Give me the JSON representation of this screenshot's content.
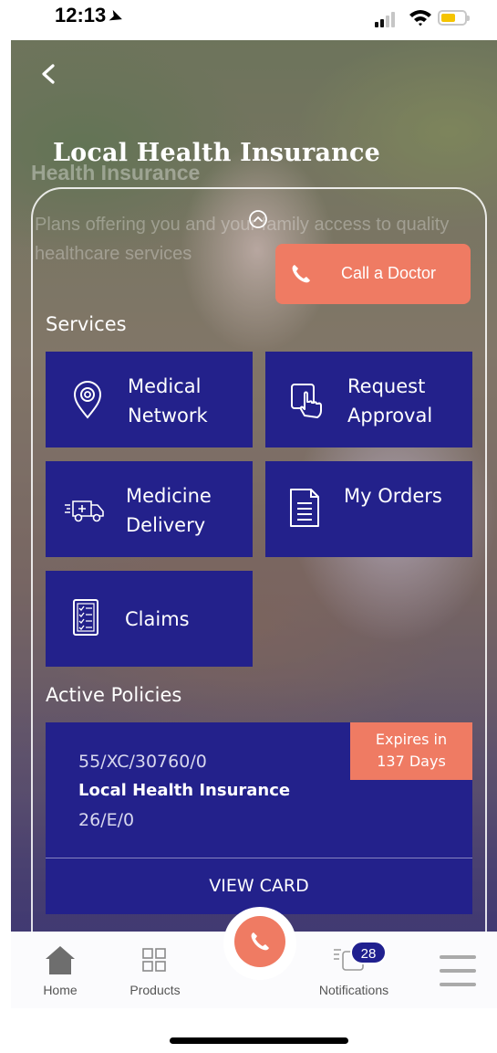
{
  "status_bar": {
    "time": "12:13",
    "location_arrow": "➤"
  },
  "header": {
    "title": "Local Health Insurance",
    "ghost_title": "Health Insurance",
    "ghost_description": "Plans offering you and your family access to quality healthcare services",
    "back_icon": "chevron-left-icon"
  },
  "actions": {
    "call_doctor_label": "Call a Doctor"
  },
  "services": {
    "heading": "Services",
    "items": [
      {
        "label": "Medical Network",
        "icon": "location-pin-icon"
      },
      {
        "label": "Request Approval",
        "icon": "tap-hand-icon"
      },
      {
        "label": "Medicine Delivery",
        "icon": "ambulance-icon"
      },
      {
        "label": "My Orders",
        "icon": "document-icon"
      },
      {
        "label": "Claims",
        "icon": "checklist-icon"
      }
    ]
  },
  "policies": {
    "heading": "Active Policies",
    "items": [
      {
        "number": "55/XC/30760/0",
        "name": "Local Health Insurance",
        "code": "26/E/0",
        "expires_line1": "Expires in",
        "expires_line2": "137 Days",
        "view_card_label": "VIEW CARD"
      }
    ]
  },
  "tab_bar": {
    "home_label": "Home",
    "products_label": "Products",
    "notifications_label": "Notifications",
    "notifications_count": "28"
  },
  "colors": {
    "accent": "#ef7b63",
    "tile": "#23218b",
    "badge": "#20208f"
  }
}
